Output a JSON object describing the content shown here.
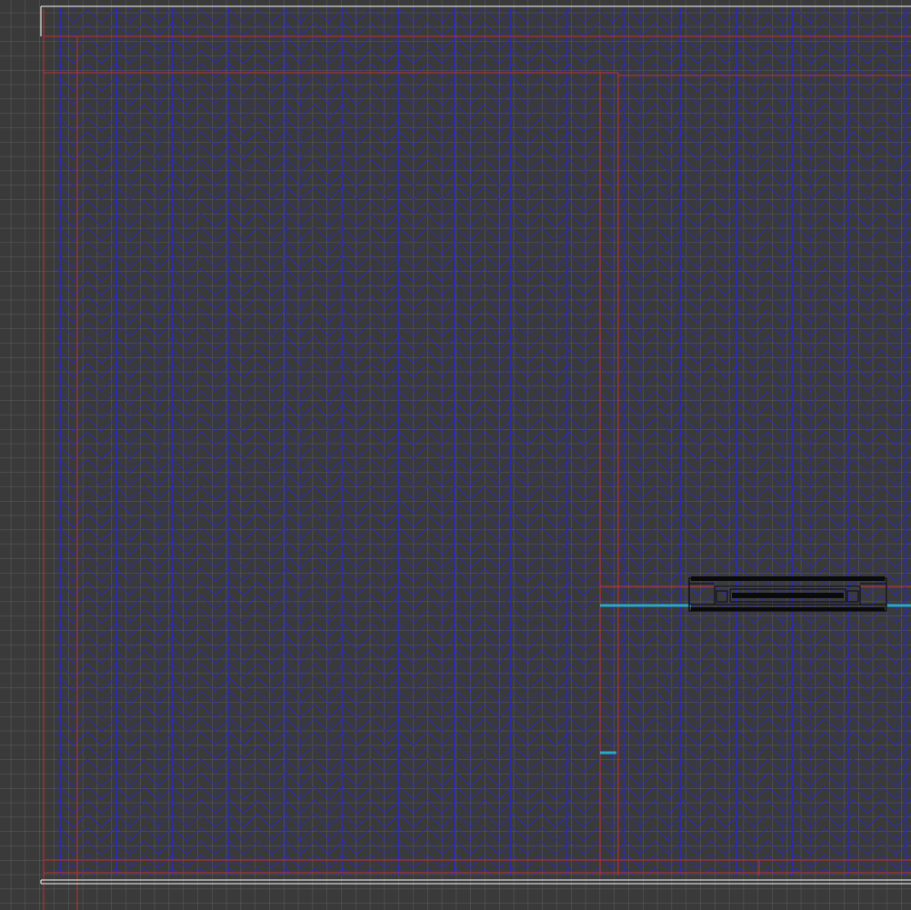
{
  "viewport": {
    "background_color": "#3a3a3a",
    "grid_color": "#5c5c5c",
    "hatch_color": "#2a2ab8",
    "boundary_color": "#c03030",
    "outline_color": "#d8d8d8",
    "selection_color": "#2aa8c8",
    "object_color": "#0a0a0a"
  },
  "objects": {
    "room_floor": {
      "hatch_pattern": "herringbone"
    },
    "wall_outline": {},
    "section_marker_main": {},
    "section_marker_small": {},
    "fixture": {}
  }
}
